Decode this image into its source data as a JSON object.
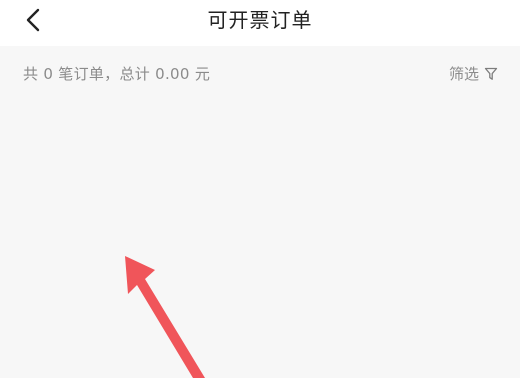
{
  "header": {
    "title": "可开票订单",
    "back_icon": "chevron-left-icon"
  },
  "summary": {
    "text": "共 0 笔订单，总计 0.00 元"
  },
  "filter": {
    "label": "筛选",
    "icon": "filter-funnel-icon"
  },
  "annotation": {
    "icon": "red-pointer-arrow",
    "color": "#f0555a"
  },
  "colors": {
    "header_bg": "#ffffff",
    "page_bg": "#f7f7f7",
    "title_text": "#222222",
    "secondary_text": "#8b8b8b"
  }
}
